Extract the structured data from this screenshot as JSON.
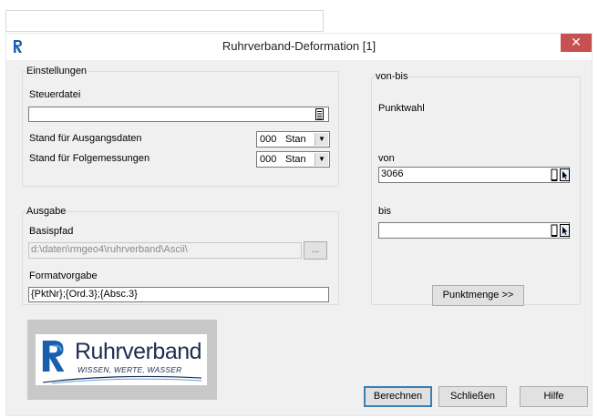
{
  "window": {
    "title": "Ruhrverband-Deformation [1]",
    "close_glyph": "✕"
  },
  "einstellungen": {
    "legend": "Einstellungen",
    "steuerdatei_label": "Steuerdatei",
    "steuerdatei_value": "",
    "ausgang_label": "Stand für Ausgangsdaten",
    "ausgang_num": "000",
    "ausgang_text": "Stan",
    "folge_label": "Stand für Folgemessungen",
    "folge_num": "000",
    "folge_text": "Stan",
    "dropdown_glyph": "▼"
  },
  "ausgabe": {
    "legend": "Ausgabe",
    "basispfad_label": "Basispfad",
    "basispfad_value": "d:\\daten\\rmgeo4\\ruhrverband\\Ascii\\",
    "browse_label": "...",
    "format_label": "Formatvorgabe",
    "format_value": "{PktNr};{Ord.3};{Absc.3}"
  },
  "vonbis": {
    "legend": "von-bis",
    "punktwahl_label": "Punktwahl",
    "von_label": "von",
    "von_value": "3066",
    "bis_label": "bis",
    "bis_value": "",
    "punktmenge_button": "Punktmenge >>"
  },
  "logo": {
    "brand": "Ruhrverband",
    "slogan": "WISSEN, WERTE, WASSER"
  },
  "buttons": {
    "berechnen": "Berechnen",
    "schliessen": "Schließen",
    "hilfe": "Hilfe"
  },
  "icons": {
    "file_browse": "file-browse-icon",
    "point_select": "point-select-icon",
    "cursor_pick": "cursor-pick-icon"
  },
  "colors": {
    "close_button": "#c75050",
    "logo_blue": "#1a5fad",
    "logo_navy": "#1e2d4f"
  }
}
